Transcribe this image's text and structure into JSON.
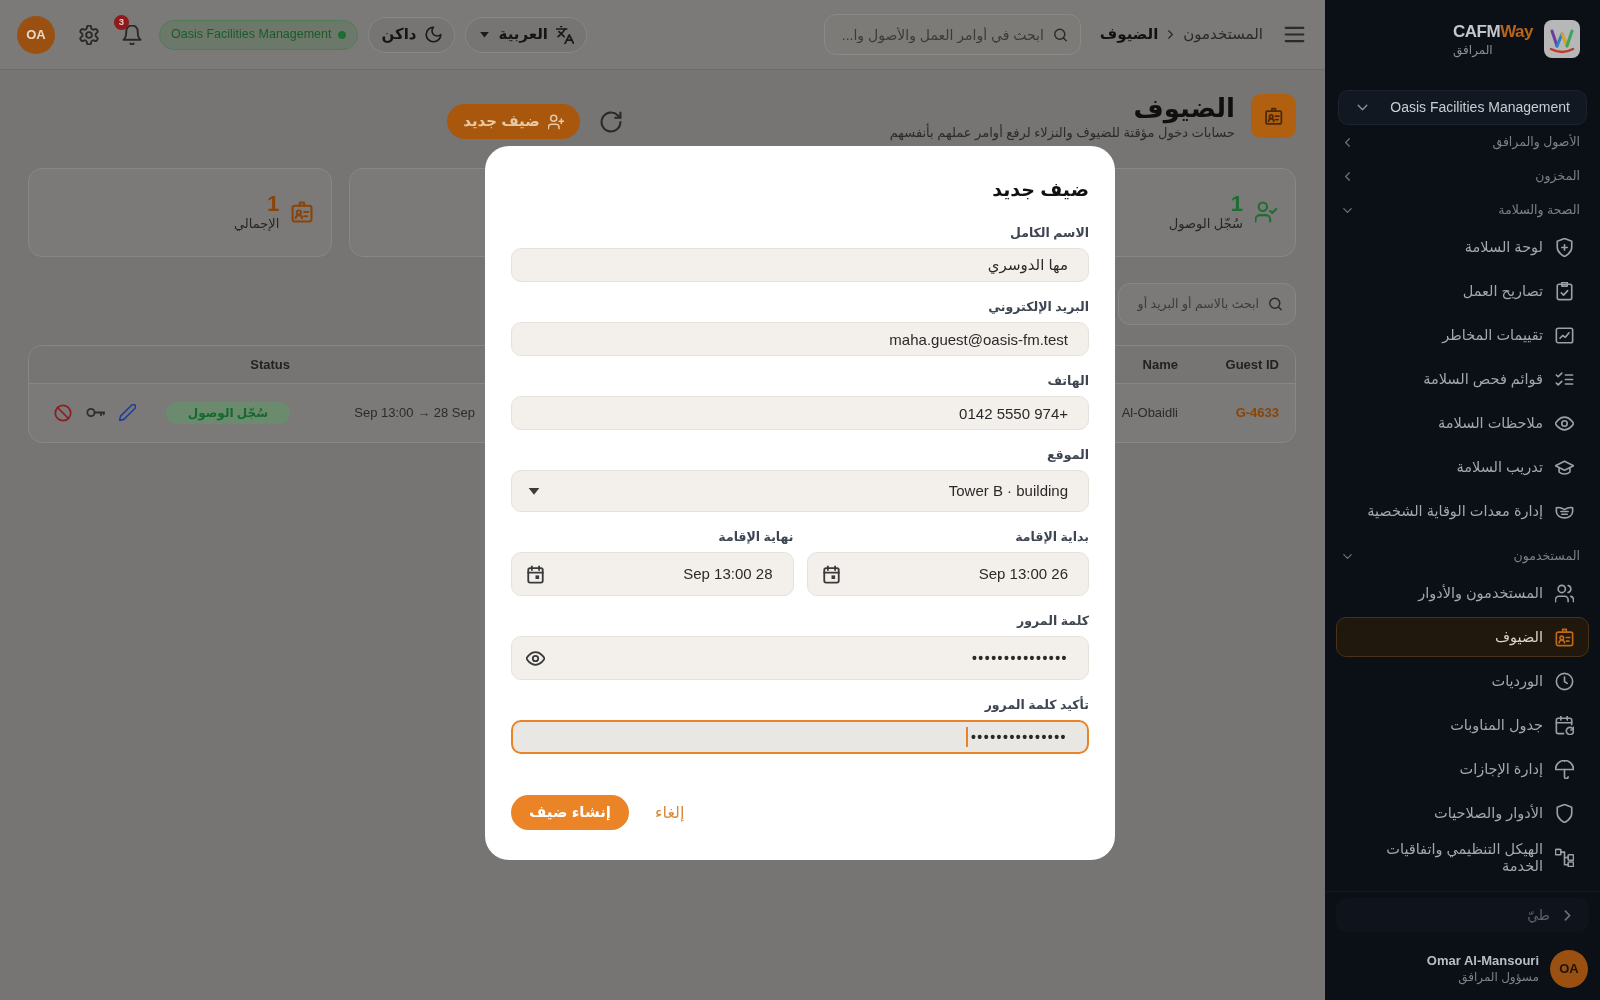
{
  "sidebar": {
    "brand": {
      "name": "CAFM",
      "name_accent": "Way",
      "subtitle": "المرافق"
    },
    "organization": "Oasis Facilities Management",
    "groups": [
      {
        "label": "الأصول والمرافق",
        "expanded": false
      },
      {
        "label": "المخزون",
        "expanded": false
      },
      {
        "label": "الصحة والسلامة",
        "expanded": true,
        "items": [
          {
            "label": "لوحة السلامة",
            "selected": false
          },
          {
            "label": "تصاريح العمل",
            "selected": false
          },
          {
            "label": "تقييمات المخاطر",
            "selected": false
          },
          {
            "label": "قوائم فحص السلامة",
            "selected": false
          },
          {
            "label": "ملاحظات السلامة",
            "selected": false
          },
          {
            "label": "تدريب السلامة",
            "selected": false
          },
          {
            "label": "إدارة معدات الوقاية الشخصية",
            "selected": false
          }
        ]
      },
      {
        "label": "المستخدمون",
        "expanded": true,
        "items": [
          {
            "label": "المستخدمون والأدوار",
            "selected": false
          },
          {
            "label": "الضيوف",
            "selected": true
          },
          {
            "label": "الورديات",
            "selected": false
          },
          {
            "label": "جدول المناوبات",
            "selected": false
          },
          {
            "label": "إدارة الإجازات",
            "selected": false
          },
          {
            "label": "الأدوار والصلاحيات",
            "selected": false
          },
          {
            "label": "الهيكل التنظيمي واتفاقيات الخدمة",
            "selected": false
          }
        ]
      }
    ],
    "collapse_label": "طيّ",
    "user": {
      "initials": "OA",
      "name": "Omar Al-Mansouri",
      "role": "مسؤول المرافق"
    }
  },
  "topbar": {
    "breadcrumbs": [
      {
        "label": "المستخدمون",
        "current": false
      },
      {
        "label": "الضيوف",
        "current": true
      }
    ],
    "search_placeholder": "ابحث في أوامر العمل والأصول وا...",
    "language": "العربية",
    "theme": "داكن",
    "organization": {
      "label": "Oasis Facilities Management",
      "active": true
    },
    "notifications_count": "3",
    "avatar_initials": "OA"
  },
  "page": {
    "title": "الضيوف",
    "subtitle": "حسابات دخول مؤقتة للضيوف والنزلاء لرفع أوامر عملهم بأنفسهم",
    "new_button": "ضيف جديد"
  },
  "stat_cards": [
    {
      "value": "1",
      "label": "سُجّل الوصول",
      "color": "#1d6e33"
    },
    {
      "value": "1",
      "label": "الإجمالي",
      "color": "#8a4408"
    }
  ],
  "search": {
    "placeholder": "ابحث بالاسم أو البريد أو"
  },
  "table": {
    "columns": [
      {
        "label": "Guest ID"
      },
      {
        "label": "Name"
      },
      {
        "label": "Status"
      }
    ],
    "rows": [
      {
        "guest_id": "G-4633",
        "name": "Al-Obaidli",
        "column_3": "Sep 13:00 → 28 Sep",
        "status": {
          "label": "سُجّل الوصول",
          "kind": "checked_in"
        }
      }
    ]
  },
  "modal": {
    "title": "ضيف جديد",
    "fields": [
      {
        "kind": "text",
        "label": "الاسم الكامل",
        "value": "مها الدوسري",
        "focused": false
      },
      {
        "kind": "text",
        "label": "البريد الإلكتروني",
        "value": "maha.guest@oasis-fm.test",
        "focused": false
      },
      {
        "kind": "text",
        "label": "الهاتف",
        "value": "+974 5550 0142",
        "focused": false
      },
      {
        "kind": "select",
        "label": "الموقع",
        "value": "Tower B · building",
        "focused": false
      },
      {
        "kind": "date",
        "label": "بداية الإقامة",
        "value": "26 Sep 13:00",
        "focused": false
      },
      {
        "kind": "date",
        "label": "نهاية الإقامة",
        "value": "28 Sep 13:00",
        "focused": false
      },
      {
        "kind": "password",
        "label": "كلمة المرور",
        "masked_value": "•••••••••••••••",
        "reveal_toggle": true,
        "focused": false
      },
      {
        "kind": "password",
        "label": "تأكيد كلمة المرور",
        "masked_value": "•••••••••••••••",
        "reveal_toggle": false,
        "focused": true
      }
    ],
    "cancel_label": "إلغاء",
    "submit_label": "إنشاء ضيف"
  }
}
